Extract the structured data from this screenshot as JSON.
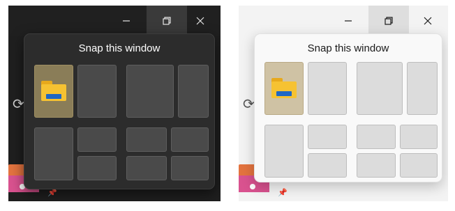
{
  "flyout": {
    "title": "Snap this window"
  },
  "window_controls": {
    "minimize": "minimize-icon",
    "restore": "restore-icon",
    "close": "close-icon"
  },
  "themes": [
    {
      "name": "dark",
      "accent": "#8a7d58"
    },
    {
      "name": "light",
      "accent": "#cfc2a4"
    }
  ],
  "layouts": [
    {
      "zones": 2,
      "active_zone": 1
    },
    {
      "zones": 2
    },
    {
      "zones": 3
    },
    {
      "zones": 4
    }
  ],
  "active_app_icon": "file-explorer-folder-icon"
}
